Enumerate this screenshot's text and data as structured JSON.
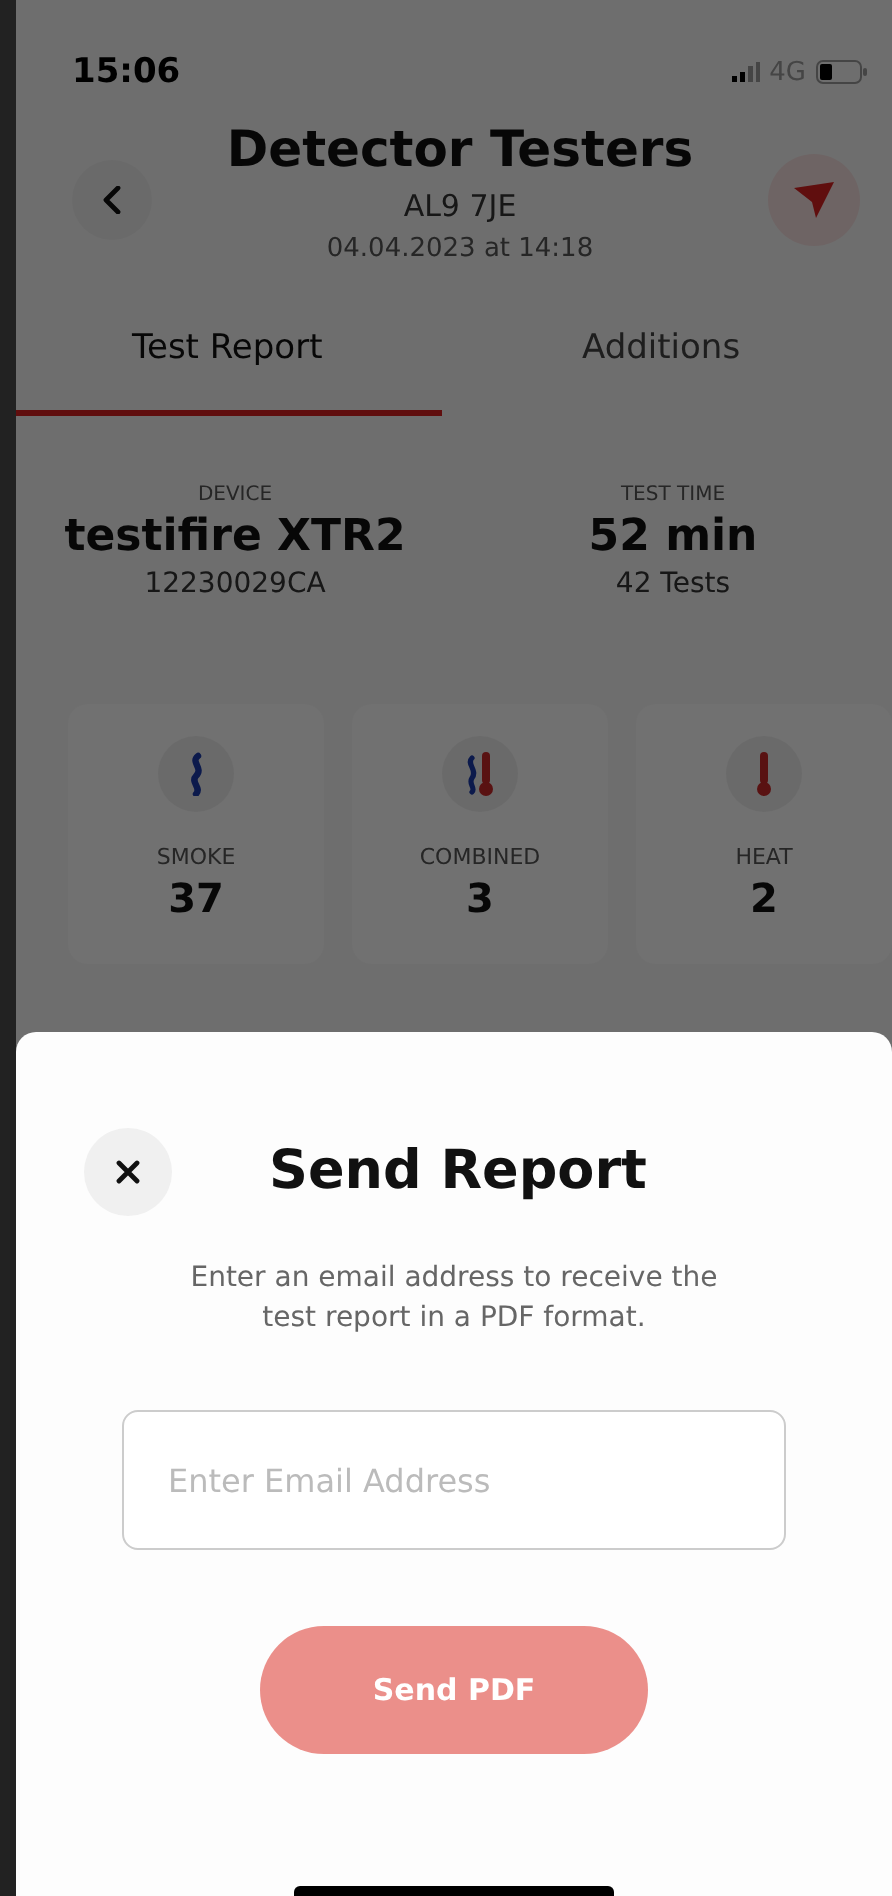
{
  "status_bar": {
    "time": "15:06",
    "network": "4G"
  },
  "header": {
    "title": "Detector Testers",
    "subtitle": "AL9 7JE",
    "date": "04.04.2023 at 14:18"
  },
  "tabs": [
    {
      "label": "Test Report",
      "selected": true
    },
    {
      "label": "Additions",
      "selected": false
    }
  ],
  "summary": [
    {
      "label": "DEVICE",
      "value": "testifire XTR2",
      "detail": "12230029CA"
    },
    {
      "label": "TEST TIME",
      "value": "52 min",
      "detail": "42 Tests"
    }
  ],
  "categories": [
    {
      "kind": "smoke",
      "label": "SMOKE",
      "count": "37"
    },
    {
      "kind": "combined",
      "label": "COMBINED",
      "count": "3"
    },
    {
      "kind": "heat",
      "label": "HEAT",
      "count": "2"
    }
  ],
  "sheet": {
    "title": "Send Report",
    "description": "Enter an email address to receive the test report in a PDF format.",
    "email": {
      "placeholder": "Enter Email Address"
    },
    "send_button": {
      "label": "Send PDF",
      "disabled": true
    }
  }
}
